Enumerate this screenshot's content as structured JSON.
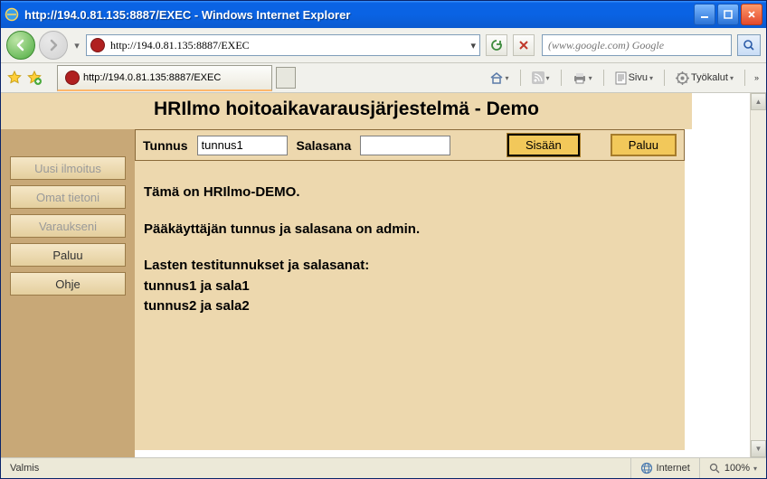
{
  "window": {
    "title": "http://194.0.81.135:8887/EXEC - Windows Internet Explorer"
  },
  "address": {
    "url": "http://194.0.81.135:8887/EXEC"
  },
  "search": {
    "placeholder": "(www.google.com) Google"
  },
  "tab": {
    "label": "http://194.0.81.135:8887/EXEC"
  },
  "toolbar": {
    "page_label": "Sivu",
    "tools_label": "Työkalut"
  },
  "app": {
    "title": "HRIlmo hoitoaikavarausjärjestelmä - Demo",
    "sidebar": {
      "items": [
        {
          "label": "Uusi ilmoitus",
          "enabled": false
        },
        {
          "label": "Omat tietoni",
          "enabled": false
        },
        {
          "label": "Varaukseni",
          "enabled": false
        },
        {
          "label": "Paluu",
          "enabled": true
        },
        {
          "label": "Ohje",
          "enabled": true
        }
      ]
    },
    "login": {
      "user_label": "Tunnus",
      "user_value": "tunnus1",
      "pass_label": "Salasana",
      "pass_value": "",
      "submit": "Sisään",
      "back": "Paluu"
    },
    "body": {
      "line1": "Tämä on HRIlmo-DEMO.",
      "line2": "Pääkäyttäjän tunnus ja salasana on admin.",
      "line3": "Lasten testitunnukset ja salasanat:",
      "line4": "tunnus1 ja sala1",
      "line5": "tunnus2 ja sala2"
    }
  },
  "status": {
    "ready": "Valmis",
    "zone": "Internet",
    "zoom": "100%"
  }
}
